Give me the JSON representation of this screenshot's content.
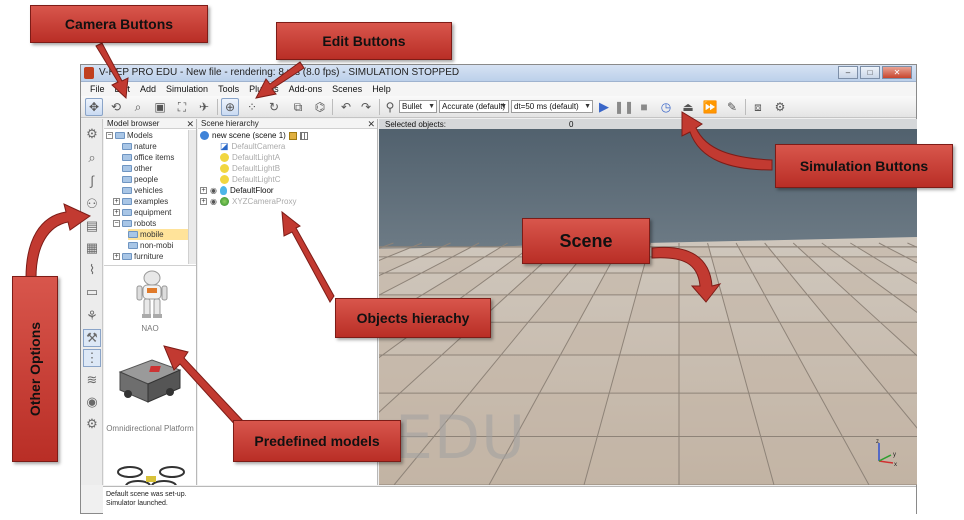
{
  "window": {
    "title": "V-REP PRO EDU - New file - rendering: 8 ms (8.0 fps) - SIMULATION STOPPED",
    "controls": [
      "–",
      "□",
      "✕"
    ]
  },
  "menu": {
    "items": [
      "File",
      "Edit",
      "Add",
      "Simulation",
      "Tools",
      "Plugins",
      "Add-ons",
      "Scenes",
      "Help"
    ]
  },
  "toolbar": {
    "engine": "Bullet",
    "accuracy": "Accurate (default)",
    "timestep": "dt=50 ms (default)",
    "camera_buttons": [
      "move-camera-icon",
      "rotate-camera-icon",
      "zoom-camera-icon",
      "camera-fit-icon",
      "camera-angle-icon",
      "camera-pan-icon"
    ],
    "edit_buttons": [
      "click-select-icon",
      "object-shift-icon",
      "object-rotate-icon",
      "assemble-icon",
      "transfer-dna-icon",
      "undo-icon",
      "redo-icon"
    ],
    "simulation_buttons": [
      "play-icon",
      "pause-icon",
      "stop-icon",
      "real-time-icon",
      "slower-icon",
      "faster-icon",
      "thread-rendering-icon"
    ]
  },
  "model_browser": {
    "title": "Model browser",
    "tree": [
      {
        "label": "Models",
        "depth": 0,
        "expander": "⊟"
      },
      {
        "label": "nature",
        "depth": 1,
        "expander": ""
      },
      {
        "label": "office items",
        "depth": 1,
        "expander": ""
      },
      {
        "label": "other",
        "depth": 1,
        "expander": ""
      },
      {
        "label": "people",
        "depth": 1,
        "expander": ""
      },
      {
        "label": "vehicles",
        "depth": 1,
        "expander": ""
      },
      {
        "label": "examples",
        "depth": 1,
        "expander": "⊞"
      },
      {
        "label": "equipment",
        "depth": 1,
        "expander": "⊞"
      },
      {
        "label": "robots",
        "depth": 1,
        "expander": "⊟"
      },
      {
        "label": "mobile",
        "depth": 2,
        "expander": "",
        "selected": true
      },
      {
        "label": "non-mobi",
        "depth": 2,
        "expander": ""
      },
      {
        "label": "furniture",
        "depth": 1,
        "expander": "⊞"
      }
    ],
    "models": [
      "NAO",
      "Omnidirectional Platform"
    ]
  },
  "scene_hierarchy": {
    "title": "Scene hierarchy",
    "root": "new scene (scene 1)",
    "items": [
      {
        "label": "DefaultCamera",
        "dim": true
      },
      {
        "label": "DefaultLightA",
        "dim": true
      },
      {
        "label": "DefaultLightB",
        "dim": true
      },
      {
        "label": "DefaultLightC",
        "dim": true
      },
      {
        "label": "DefaultFloor",
        "dim": false
      },
      {
        "label": "XYZCameraProxy",
        "dim": true
      }
    ]
  },
  "viewport": {
    "selected_label": "Selected objects:",
    "selected_count": "0",
    "watermark": "EDU",
    "axes": [
      "x",
      "y",
      "z"
    ]
  },
  "status": {
    "lines": [
      "Default scene was set-up.",
      "Simulator launched."
    ]
  },
  "annotations": {
    "camera_buttons": "Camera Buttons",
    "edit_buttons": "Edit Buttons",
    "simulation_buttons": "Simulation Buttons",
    "scene": "Scene",
    "objects_hierarchy": "Objects hierachy",
    "predefined_models": "Predefined models",
    "other_options": "Other Options"
  },
  "colors": {
    "callout": "#c23a31",
    "floor_light": "#d6ccbf",
    "floor_dark": "#c4b7a8",
    "sky": "#6d7c89",
    "selection": "#ffe39a"
  }
}
